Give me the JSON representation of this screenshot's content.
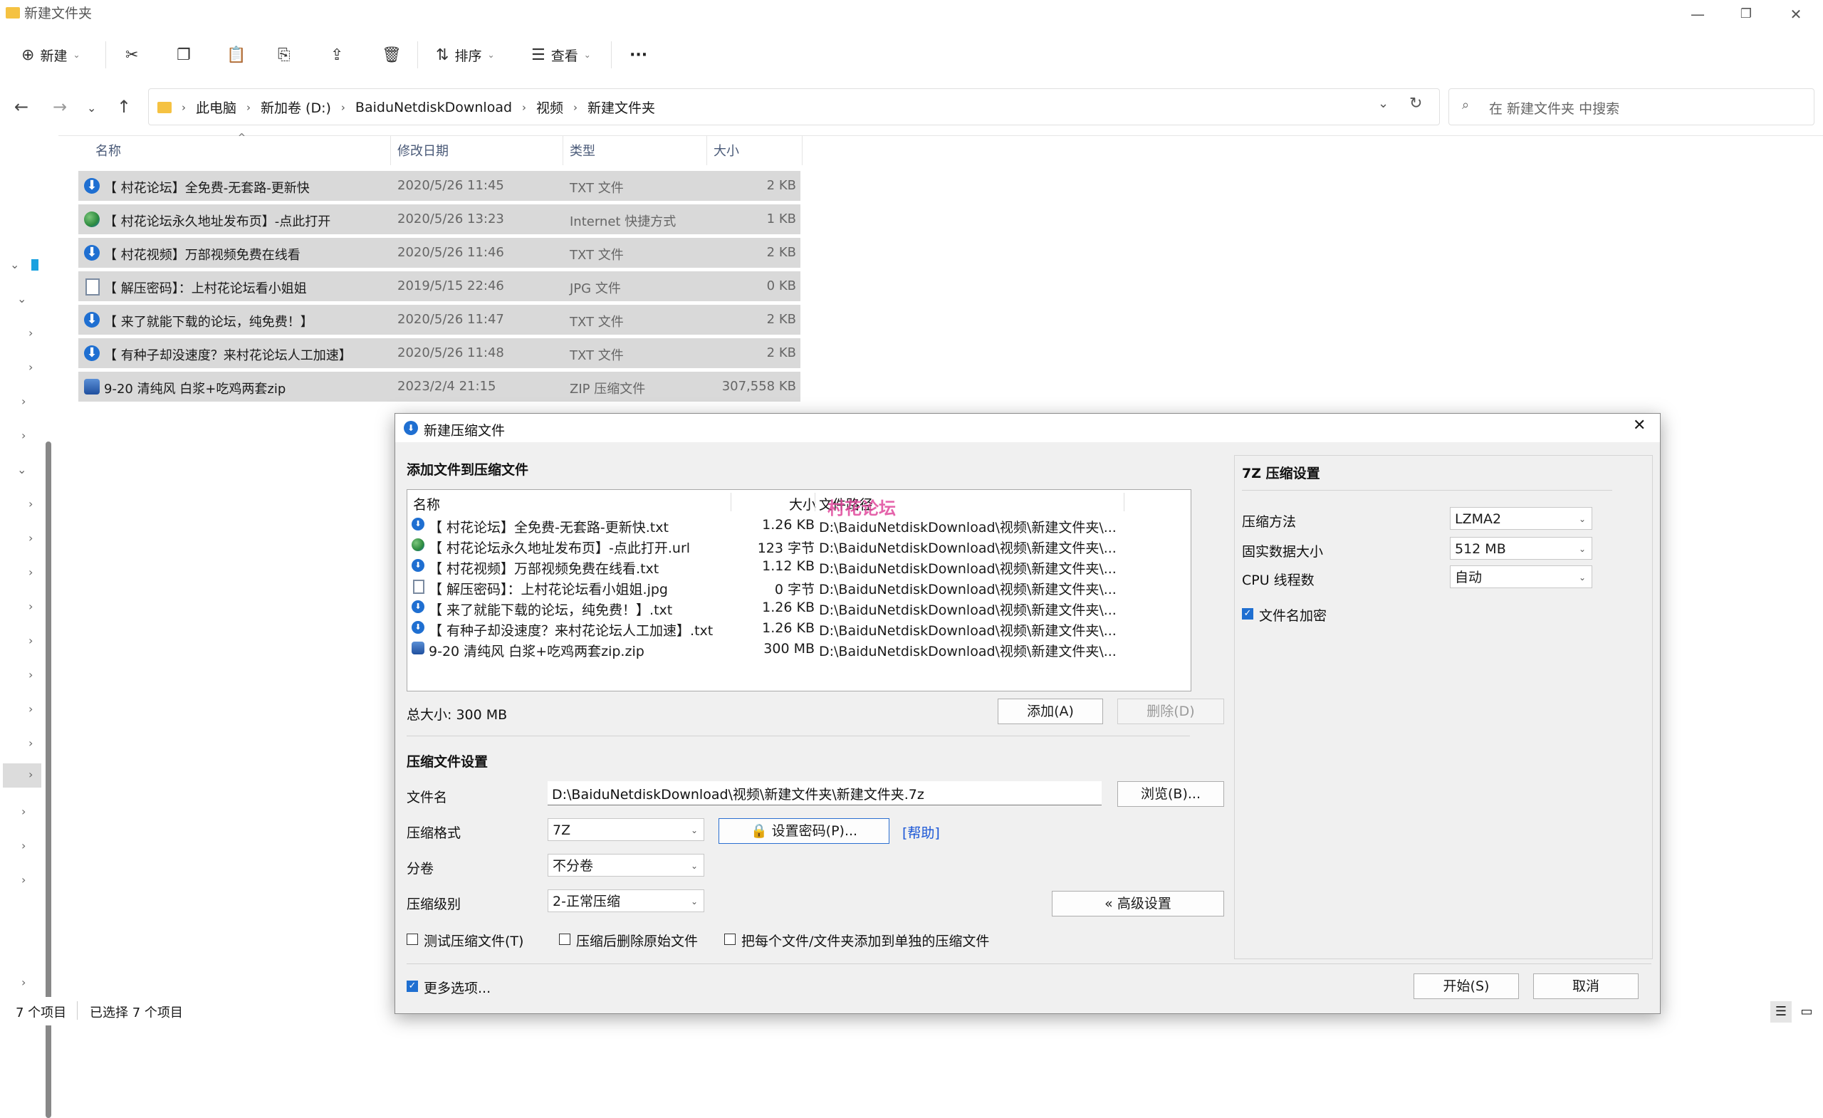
{
  "window": {
    "title": "新建文件夹"
  },
  "toolbar": {
    "new_label": "新建",
    "sort_label": "排序",
    "view_label": "查看",
    "more_label": "···"
  },
  "address": {
    "crumbs": [
      "此电脑",
      "新加卷 (D:)",
      "BaiduNetdiskDownload",
      "视频",
      "新建文件夹"
    ],
    "search_placeholder": "在 新建文件夹 中搜索"
  },
  "filelist": {
    "headers": {
      "name": "名称",
      "date": "修改日期",
      "type": "类型",
      "size": "大小"
    },
    "rows": [
      {
        "name": "【 村花论坛】全免费-无套路-更新快",
        "date": "2020/5/26 11:45",
        "type": "TXT 文件",
        "size": "2 KB",
        "icon": "blue-circle-icon"
      },
      {
        "name": "【 村花论坛永久地址发布页】-点此打开",
        "date": "2020/5/26 13:23",
        "type": "Internet 快捷方式",
        "size": "1 KB",
        "icon": "globe-icon"
      },
      {
        "name": "【 村花视频】万部视频免费在线看",
        "date": "2020/5/26 11:46",
        "type": "TXT 文件",
        "size": "2 KB",
        "icon": "blue-circle-icon"
      },
      {
        "name": "【 解压密码】：上村花论坛看小姐姐",
        "date": "2019/5/15 22:46",
        "type": "JPG 文件",
        "size": "0 KB",
        "icon": "document-icon"
      },
      {
        "name": "【 来了就能下载的论坛，纯免费！】",
        "date": "2020/5/26 11:47",
        "type": "TXT 文件",
        "size": "2 KB",
        "icon": "blue-circle-icon"
      },
      {
        "name": "【 有种子却没速度？来村花论坛人工加速】",
        "date": "2020/5/26 11:48",
        "type": "TXT 文件",
        "size": "2 KB",
        "icon": "blue-circle-icon"
      },
      {
        "name": "9-20 清纯风 白浆+吃鸡两套zip",
        "date": "2023/2/4 21:15",
        "type": "ZIP 压缩文件",
        "size": "307,558 KB",
        "icon": "zip-archive-icon"
      }
    ]
  },
  "status": {
    "count": "7 个项目",
    "selected": "已选择 7 个项目"
  },
  "dialog": {
    "title": "新建压缩文件",
    "add_section_title": "添加文件到压缩文件",
    "list_headers": {
      "name": "名称",
      "size": "大小",
      "path": "文件路径"
    },
    "watermark": "村花论坛",
    "list_rows": [
      {
        "name": "【 村花论坛】全免费-无套路-更新快.txt",
        "size": "1.26 KB",
        "path": "D:\\BaiduNetdiskDownload\\视频\\新建文件夹\\..."
      },
      {
        "name": "【 村花论坛永久地址发布页】-点此打开.url",
        "size": "123 字节",
        "path": "D:\\BaiduNetdiskDownload\\视频\\新建文件夹\\..."
      },
      {
        "name": "【 村花视频】万部视频免费在线看.txt",
        "size": "1.12 KB",
        "path": "D:\\BaiduNetdiskDownload\\视频\\新建文件夹\\..."
      },
      {
        "name": "【 解压密码】：上村花论坛看小姐姐.jpg",
        "size": "0 字节",
        "path": "D:\\BaiduNetdiskDownload\\视频\\新建文件夹\\..."
      },
      {
        "name": "【 来了就能下载的论坛，纯免费！】.txt",
        "size": "1.26 KB",
        "path": "D:\\BaiduNetdiskDownload\\视频\\新建文件夹\\..."
      },
      {
        "name": "【 有种子却没速度？来村花论坛人工加速】.txt",
        "size": "1.26 KB",
        "path": "D:\\BaiduNetdiskDownload\\视频\\新建文件夹\\..."
      },
      {
        "name": "9-20 清纯风 白浆+吃鸡两套zip.zip",
        "size": "300 MB",
        "path": "D:\\BaiduNetdiskDownload\\视频\\新建文件夹\\..."
      }
    ],
    "total_size": "总大小: 300 MB",
    "add_button": "添加(A)",
    "delete_button": "删除(D)",
    "compress_section_title": "压缩文件设置",
    "filename_label": "文件名",
    "filename_value": "D:\\BaiduNetdiskDownload\\视频\\新建文件夹\\新建文件夹.7z",
    "browse_button": "浏览(B)...",
    "format_label": "压缩格式",
    "format_value": "7Z",
    "set_password_button": "设置密码(P)...",
    "help_link": "[帮助]",
    "split_label": "分卷",
    "split_value": "不分卷",
    "level_label": "压缩级别",
    "level_value": "2-正常压缩",
    "advanced_button": "« 高级设置",
    "opt_test": "测试压缩文件(T)",
    "opt_delete": "压缩后删除原始文件",
    "opt_each": "把每个文件/文件夹添加到单独的压缩文件",
    "more_options": "更多选项...",
    "start_button": "开始(S)",
    "cancel_button": "取消",
    "seven_z": {
      "title": "7Z 压缩设置",
      "method_label": "压缩方法",
      "method_value": "LZMA2",
      "solid_label": "固实数据大小",
      "solid_value": "512 MB",
      "threads_label": "CPU 线程数",
      "threads_value": "自动",
      "encrypt_names": "文件名加密"
    }
  }
}
